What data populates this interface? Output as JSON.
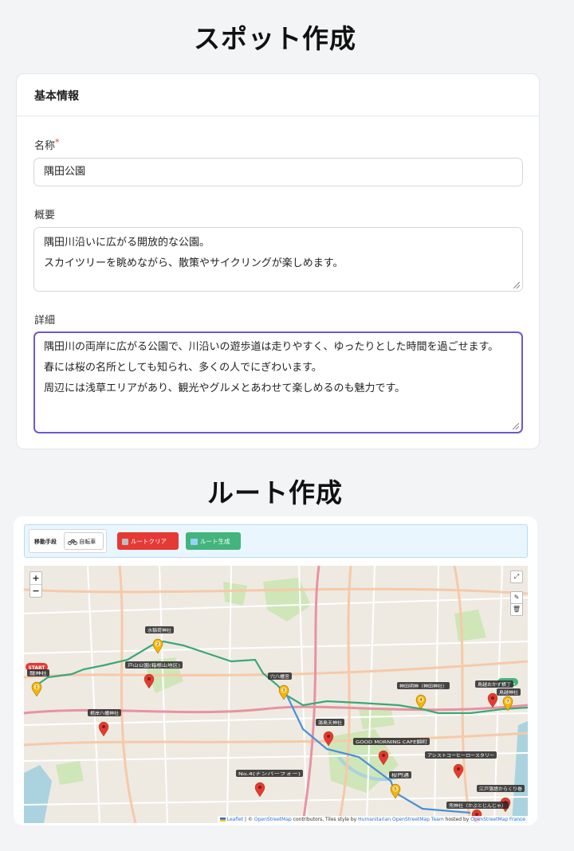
{
  "headings": {
    "spot": "スポット作成",
    "route": "ルート作成"
  },
  "basic_info": {
    "title": "基本情報",
    "name_label": "名称",
    "required_mark": "*",
    "name_value": "隅田公園",
    "summary_label": "概要",
    "summary_value": "隅田川沿いに広がる開放的な公園。\nスカイツリーを眺めながら、散策やサイクリングが楽しめます。",
    "detail_label": "詳細",
    "detail_value": "隅田川の両岸に広がる公園で、川沿いの遊歩道は走りやすく、ゆったりとした時間を過ごせます。\n春には桜の名所としても知られ、多くの人でにぎわいます。\n周辺には浅草エリアがあり、観光やグルメとあわせて楽しめるのも魅力です。"
  },
  "route": {
    "mode_label": "移動手段",
    "mode_icon": "bicycle-icon",
    "mode_value": "自転車",
    "clear_icon": "trash-icon",
    "clear_button": "ルートクリア",
    "generate_icon": "route-icon",
    "generate_button": "ルート生成",
    "map": {
      "zoom_in": "+",
      "zoom_out": "−",
      "start_badge": "START",
      "goal_badge": "GOAL",
      "route_color": "#3aa876",
      "start_color": "#e53935",
      "goal_color": "#43b47c",
      "markers": [
        {
          "label": "龍神社",
          "num": "1",
          "color": "#f5b400"
        },
        {
          "label": "水稲荷神社",
          "num": "2",
          "color": "#f5b400"
        },
        {
          "label": "戸山公園(箱根山地区)",
          "num": "",
          "color": "#e53935"
        },
        {
          "label": "穴八幡宮",
          "num": "3",
          "color": "#f5b400"
        },
        {
          "label": "根岸八幡神社",
          "num": "",
          "color": "#e53935"
        },
        {
          "label": "湯島天神社",
          "num": "",
          "color": "#e53935"
        },
        {
          "label": "神田明神（神田神社）",
          "num": "4",
          "color": "#f5b400"
        },
        {
          "label": "GOOD MORNING CAFE錦町",
          "num": "",
          "color": "#e53935"
        },
        {
          "label": "No.4(ナンバーフォー)",
          "num": "",
          "color": "#e53935"
        },
        {
          "label": "桜門通",
          "num": "5",
          "color": "#f5b400"
        },
        {
          "label": "アシストコーヒーロースタリー",
          "num": "",
          "color": "#e53935"
        },
        {
          "label": "鳥越おかず横丁",
          "num": "",
          "color": "#e53935"
        },
        {
          "label": "鳥越神社",
          "num": "7",
          "color": "#f5b400"
        },
        {
          "label": "江戸落語からくり巻",
          "num": "",
          "color": "#e53935"
        },
        {
          "label": "兜神社（かぶとじんじゃ）",
          "num": "",
          "color": "#e53935"
        }
      ],
      "attribution": {
        "leaflet": "Leaflet",
        "text1": " | © ",
        "osm": "OpenStreetMap",
        "text2": " contributors, Tiles style by ",
        "hot": "Humanitarian OpenStreetMap Team",
        "text3": " hosted by ",
        "osmfr": "OpenStreetMap France"
      }
    }
  }
}
